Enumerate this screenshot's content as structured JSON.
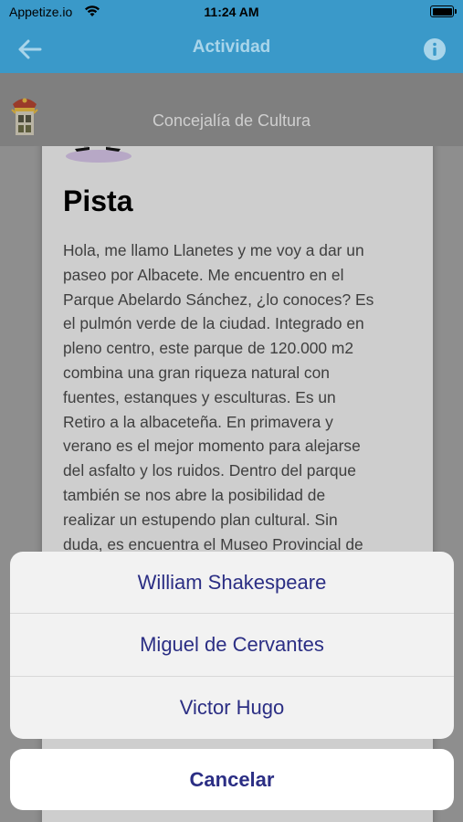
{
  "status_bar": {
    "carrier": "Appetize.io",
    "time": "11:24 AM"
  },
  "nav": {
    "title": "Actividad",
    "back_icon": "arrow-left-icon",
    "info_icon": "info-icon"
  },
  "org": {
    "title": "Concejalía de Cultura",
    "crest_icon": "crest-icon"
  },
  "card": {
    "title": "Pista",
    "body_lines": [
      "Hola, me llamo Llanetes y me voy a dar un",
      "paseo por Albacete. Me encuentro en el",
      "Parque Abelardo Sánchez, ¿lo conoces? Es",
      "el pulmón verde de la ciudad. Integrado en",
      "pleno centro, este parque de 120.000 m2",
      "combina una gran riqueza natural con",
      "fuentes, estanques y esculturas. Es un",
      "Retiro a la albaceteña. En primavera y",
      "verano es el mejor momento para alejarse",
      "del asfalto y los ruidos. Dentro del parque",
      "también se nos abre la posibilidad de",
      "realizar un estupendo plan cultural. Sin",
      "duda, es encuentra el Museo Provincial de"
    ]
  },
  "action_sheet": {
    "options": [
      "William Shakespeare",
      "Miguel de Cervantes",
      "Victor Hugo"
    ],
    "cancel_label": "Cancelar"
  },
  "colors": {
    "nav_background": "#3a99c9",
    "action_text": "#2b2e84"
  }
}
